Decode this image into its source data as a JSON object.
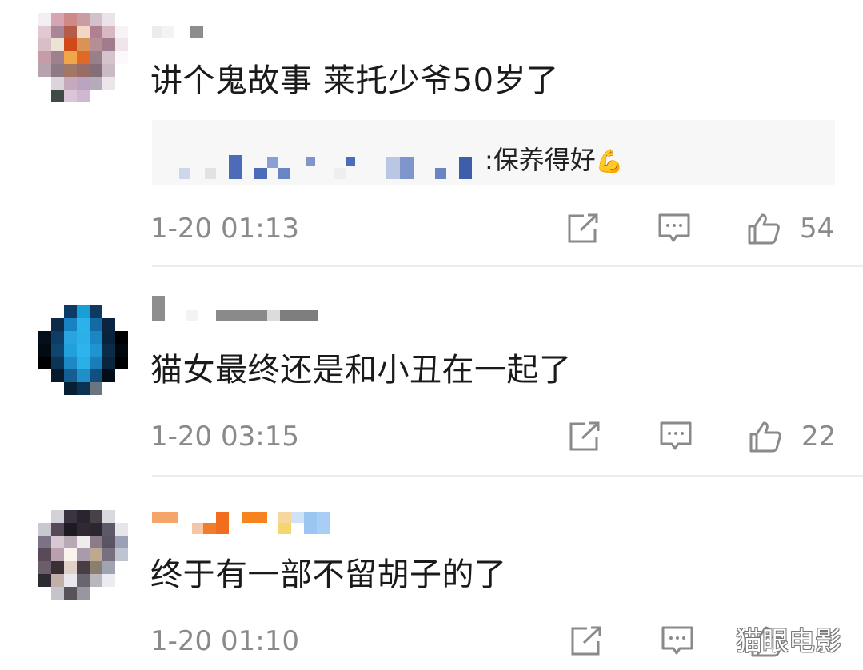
{
  "comments": [
    {
      "text": "讲个鬼故事 莱托少爷50岁了",
      "reply": {
        "text": ":保养得好",
        "emoji": "💪"
      },
      "timestamp": "1-20 01:13",
      "likes": "54"
    },
    {
      "text": "猫女最终还是和小丑在一起了",
      "timestamp": "1-20 03:15",
      "likes": "22"
    },
    {
      "text": "终于有一部不留胡子的了",
      "timestamp": "1-20 01:10",
      "likes": ""
    }
  ],
  "icons": {
    "share": "share-icon",
    "reply": "comment-icon",
    "like": "thumbs-up-icon"
  },
  "colors": {
    "meta_text": "#8a8a8a",
    "reply_bg": "#f7f7f7",
    "divider": "#ececec"
  },
  "watermark": "猫眼电影"
}
